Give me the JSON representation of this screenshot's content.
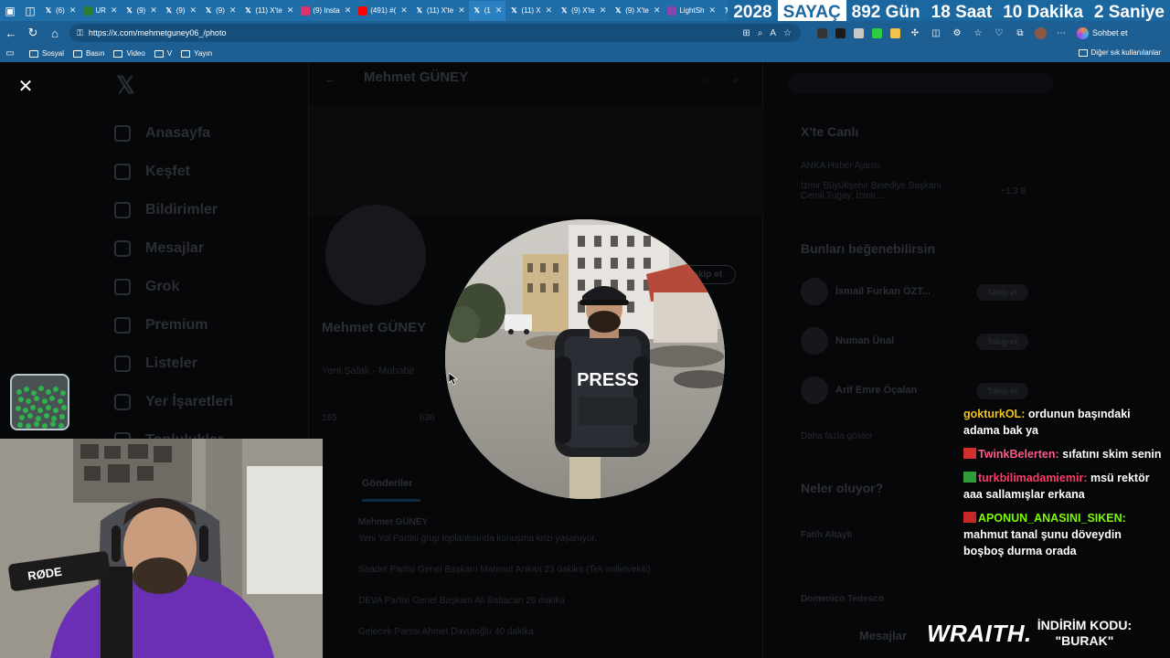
{
  "tabs": [
    {
      "title": "(6)",
      "icon": "x-logo-icon",
      "icon_color": "#000000"
    },
    {
      "title": "UR",
      "icon": "generic-site-icon",
      "icon_color": "#2e7d32"
    },
    {
      "title": "(9)",
      "icon": "x-logo-icon",
      "icon_color": "#000000"
    },
    {
      "title": "(9)",
      "icon": "x-logo-icon",
      "icon_color": "#000000"
    },
    {
      "title": "(9)",
      "icon": "x-logo-icon",
      "icon_color": "#000000"
    },
    {
      "title": "(11) X'te",
      "icon": "x-logo-icon",
      "icon_color": "#000000"
    },
    {
      "title": "(9) Insta",
      "icon": "instagram-icon",
      "icon_color": "#e1306c"
    },
    {
      "title": "(491) #(",
      "icon": "youtube-icon",
      "icon_color": "#ff0000"
    },
    {
      "title": "(11) X'te",
      "icon": "x-logo-icon",
      "icon_color": "#000000"
    },
    {
      "title": "(1",
      "icon": "x-logo-icon",
      "icon_color": "#000000",
      "active": true
    },
    {
      "title": "(11) X",
      "icon": "x-logo-icon",
      "icon_color": "#000000"
    },
    {
      "title": "(9) X'te",
      "icon": "x-logo-icon",
      "icon_color": "#000000"
    },
    {
      "title": "(9) X'te",
      "icon": "x-logo-icon",
      "icon_color": "#000000"
    },
    {
      "title": "LightSh",
      "icon": "lightshot-icon",
      "icon_color": "#8e44ad"
    },
    {
      "title": "",
      "icon": "x-logo-icon",
      "icon_color": "#000000"
    }
  ],
  "counter": {
    "year": "2028",
    "label": "SAYAÇ",
    "days": "892 Gün",
    "hours": "18 Saat",
    "minutes": "10 Dakika",
    "seconds": "2 Saniye"
  },
  "browser": {
    "url": "https://x.com/mehmetguney06_/photo",
    "chat_button": "Sohbet et"
  },
  "bookmarks": {
    "items": [
      "Sosyal",
      "Basın",
      "Video",
      "V",
      "Yayın"
    ],
    "other": "Diğer sık kullanılanlar"
  },
  "x_page": {
    "logo": "𝕏",
    "nav": [
      "Anasayfa",
      "Keşfet",
      "Bildirimler",
      "Mesajlar",
      "Grok",
      "Premium",
      "Listeler",
      "Yer İşaretleri",
      "Topluluklar"
    ],
    "header_name": "Mehmet GÜNEY",
    "profile_name": "Mehmet GÜNEY",
    "bio": "Yeni Şafak - Muhabir",
    "stats": [
      "165",
      "636"
    ],
    "follow_button": "Takip et",
    "tab_posts": "Gönderiler",
    "post_author": "Mehmet GÜNEY",
    "posts": [
      "Yeni Yol Partisi grup toplantısında konuşma krizi yaşanıyor.",
      "Saadet Partisi Genel Başkanı Mahmut Arıkan 23 dakika (Tek milletvekili)",
      "DEVA Partisi Genel Başkanı Ali Babacan 26 dakika",
      "Gelecek Partisi Ahmet Davutoğlu 40 dakika"
    ],
    "live_title": "X'te Canlı",
    "live_source": "ANKA Haber Ajansı",
    "live_text": "İzmir Büyükşehir Belediye Başkanı Cemil Tugay, İzmir ...",
    "live_count": "+1,3 B",
    "suggest_title": "Bunları beğenebilirsin",
    "suggestions": [
      {
        "name": "İsmail Furkan ÖZT..."
      },
      {
        "name": "Numan Ünal"
      },
      {
        "name": "Arif Emre Öçalan"
      }
    ],
    "suggest_button": "Takip et",
    "show_more": "Daha fazla göster",
    "trending_title": "Neler oluyor?",
    "trends": [
      "Fatih Altaylı",
      "Domenico Tedesco"
    ],
    "messages": "Mesajlar"
  },
  "chat": [
    {
      "user": "gokturkOL:",
      "text": "ordunun başındaki adama bak ya",
      "color": "#f0c419",
      "badge": ""
    },
    {
      "user": "TwinkBelerten:",
      "text": "sıfatını skim senin",
      "color": "#ff5c8a",
      "badge": "#d32f2f"
    },
    {
      "user": "turkbilimadamiemir:",
      "text": "msü rektör aaa sallamışlar erkana",
      "color": "#ff3b6b",
      "badge": "#2e9d3a"
    },
    {
      "user": "APONUN_ANASINI_SIKEN:",
      "text": "mahmut tanal şunu döveydin boşboş durma orada",
      "color": "#7cfc00",
      "badge": "#c62828"
    }
  ],
  "sponsor": {
    "brand": "WRAITH.",
    "label": "İNDİRİM KODU:",
    "code": "\"BURAK\""
  },
  "photo": {
    "vest_text": "PRESS"
  },
  "webcam": {
    "mic_brand": "RØDE"
  }
}
